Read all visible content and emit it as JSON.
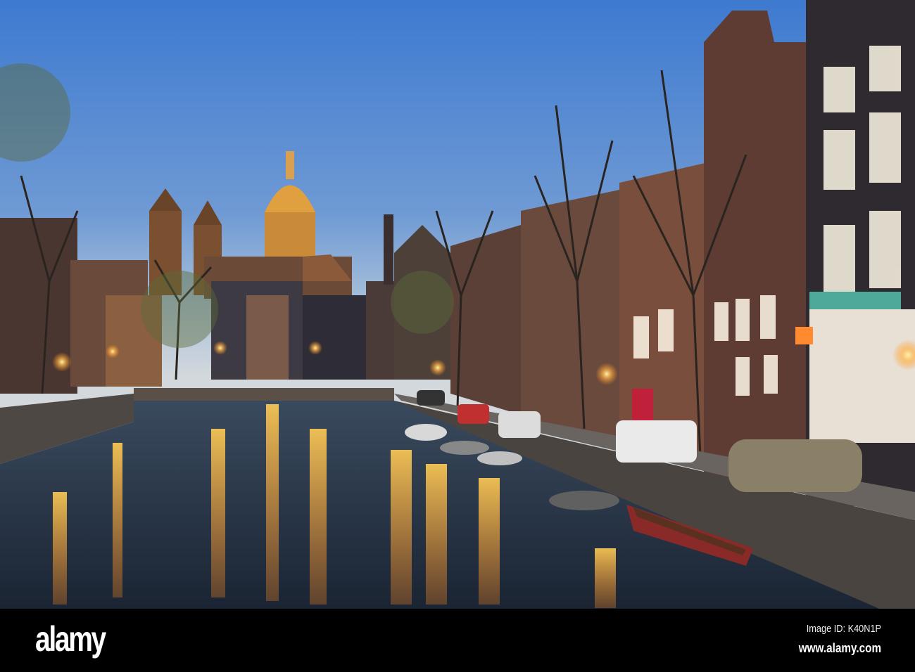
{
  "photo": {
    "subject": "Amsterdam canal at dusk with Basilica of St Nicholas",
    "colors": {
      "sky_top": "#3f7fd0",
      "sky_horizon": "#c9d6e2",
      "lamp_glow": "#ffb347",
      "water": "#1d2a3a"
    }
  },
  "watermark": {
    "logo": "alamy",
    "image_id": "Image ID: K40N1P",
    "url": "www.alamy.com"
  }
}
